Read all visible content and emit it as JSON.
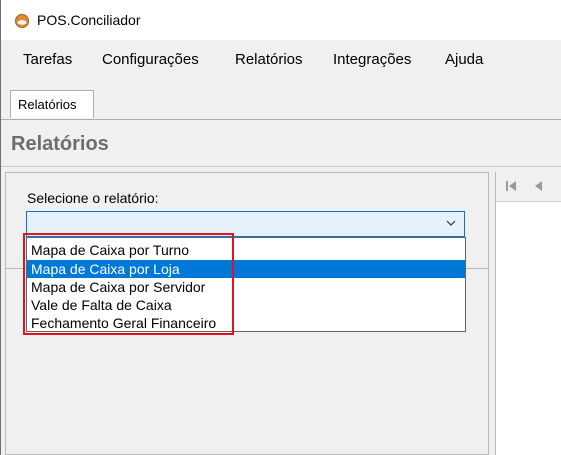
{
  "window": {
    "title": "POS.Conciliador"
  },
  "menu": {
    "items": [
      "Tarefas",
      "Configurações",
      "Relatórios",
      "Integrações",
      "Ajuda"
    ]
  },
  "tabs": {
    "active_label": "Relatórios"
  },
  "page": {
    "title": "Relatórios",
    "select_label": "Selecione o relatório:",
    "combo_value": ""
  },
  "dropdown": {
    "options": [
      "Mapa de Caixa por Turno",
      "Mapa de Caixa por Loja",
      "Mapa de Caixa por Servidor",
      "Vale de Falta de Caixa",
      "Fechamento Geral Financeiro"
    ],
    "selected_index": 1
  },
  "colors": {
    "accent": "#0078d7",
    "highlight_border": "#e0141e"
  },
  "icons": {
    "app": "pos-logo-icon",
    "combo": "chevron-down-icon",
    "nav_first": "first-page-icon",
    "nav_prev": "previous-page-icon"
  }
}
